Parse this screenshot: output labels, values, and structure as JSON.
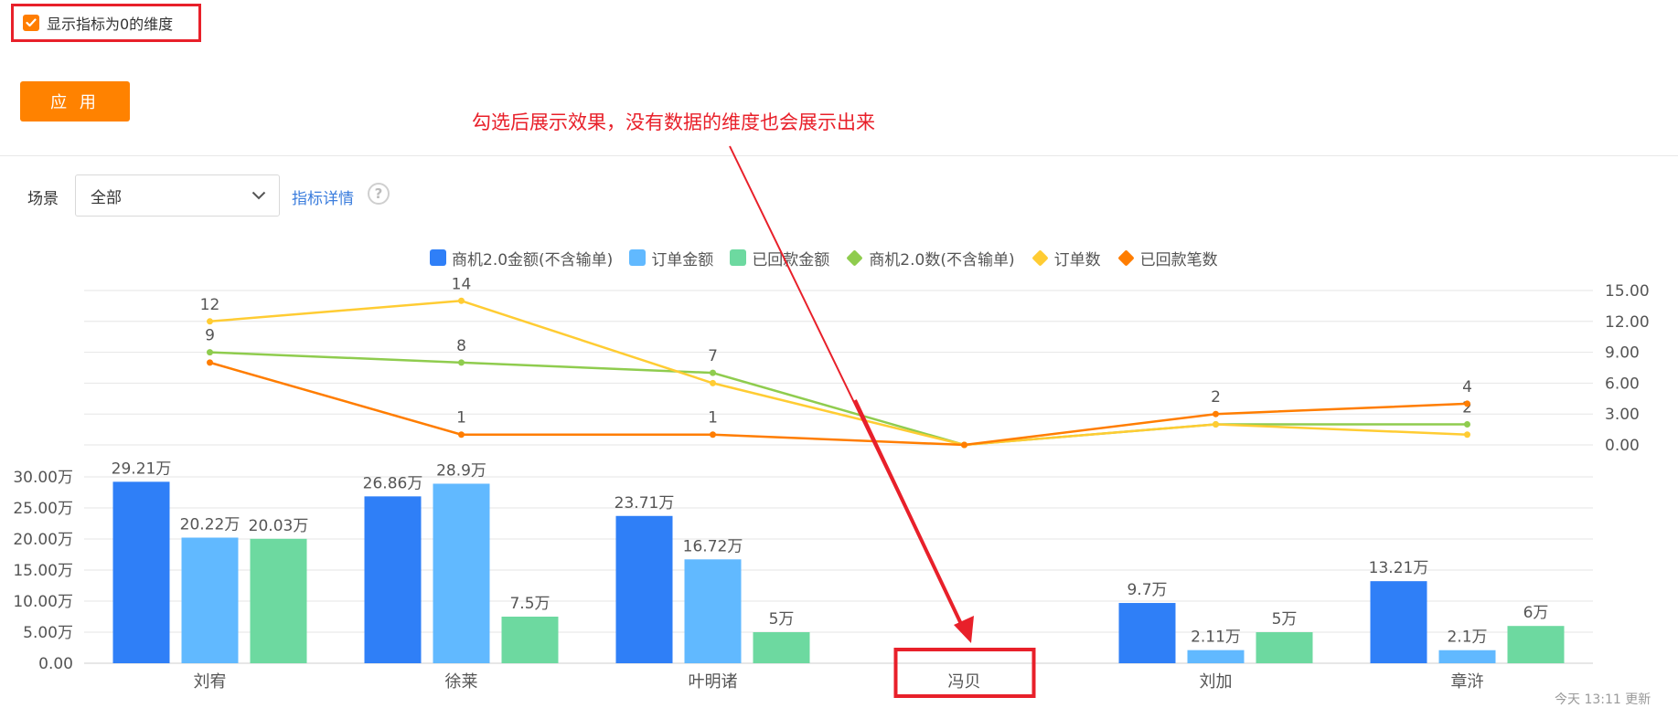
{
  "filter": {
    "show_zero_label": "显示指标为0的维度",
    "checked": true,
    "apply_label": "应 用"
  },
  "annotation": {
    "text": "勾选后展示效果，没有数据的维度也会展示出来"
  },
  "toolbar": {
    "scene_label": "场景",
    "scene_value": "全部",
    "metric_detail_label": "指标详情",
    "help_glyph": "?"
  },
  "footer": {
    "text": "今天 13:11 更新"
  },
  "colors": {
    "accent": "#ff8200",
    "annotation": "#e8202a",
    "link": "#3b7ddd"
  },
  "chart_data": {
    "type": "bar+line",
    "categories": [
      "刘宥",
      "徐莱",
      "叶明诸",
      "冯贝",
      "刘加",
      "章浒"
    ],
    "bar_series": [
      {
        "name": "商机2.0金额(不含输单)",
        "color": "#2f7ff7",
        "values": [
          29.21,
          26.86,
          23.71,
          0,
          9.7,
          13.21
        ],
        "labels": [
          "29.21万",
          "26.86万",
          "23.71万",
          "",
          "9.7万",
          "13.21万"
        ]
      },
      {
        "name": "订单金额",
        "color": "#61b9ff",
        "values": [
          20.22,
          28.9,
          16.72,
          0,
          2.11,
          2.1
        ],
        "labels": [
          "20.22万",
          "28.9万",
          "16.72万",
          "",
          "2.11万",
          "2.1万"
        ]
      },
      {
        "name": "已回款金额",
        "color": "#6dd9a0",
        "values": [
          20.03,
          7.5,
          5,
          0,
          5,
          6
        ],
        "labels": [
          "20.03万",
          "7.5万",
          "5万",
          "",
          "5万",
          "6万"
        ]
      }
    ],
    "line_series": [
      {
        "name": "商机2.0数(不含输单)",
        "color": "#8fcc4e",
        "values": [
          9,
          8,
          7,
          0,
          2,
          2
        ],
        "labels": [
          "9",
          "8",
          "7",
          "",
          "",
          "2"
        ]
      },
      {
        "name": "订单数",
        "color": "#ffcc33",
        "values": [
          12,
          14,
          6,
          0,
          2,
          1
        ],
        "labels": [
          "12",
          "14",
          "",
          "",
          "",
          ""
        ]
      },
      {
        "name": "已回款笔数",
        "color": "#ff7d00",
        "values": [
          8,
          1,
          1,
          0,
          3,
          4
        ],
        "labels": [
          "",
          "1",
          "1",
          "",
          "2",
          "4"
        ]
      }
    ],
    "bar_axis": {
      "ticks": [
        "0.00",
        "5.00万",
        "10.00万",
        "15.00万",
        "20.00万",
        "25.00万",
        "30.00万"
      ],
      "ylim": [
        0,
        30
      ]
    },
    "line_axis": {
      "ticks": [
        "0.00",
        "3.00",
        "6.00",
        "9.00",
        "12.00",
        "15.00"
      ],
      "ylim": [
        0,
        15
      ]
    },
    "grid": true,
    "legend_position": "top"
  }
}
